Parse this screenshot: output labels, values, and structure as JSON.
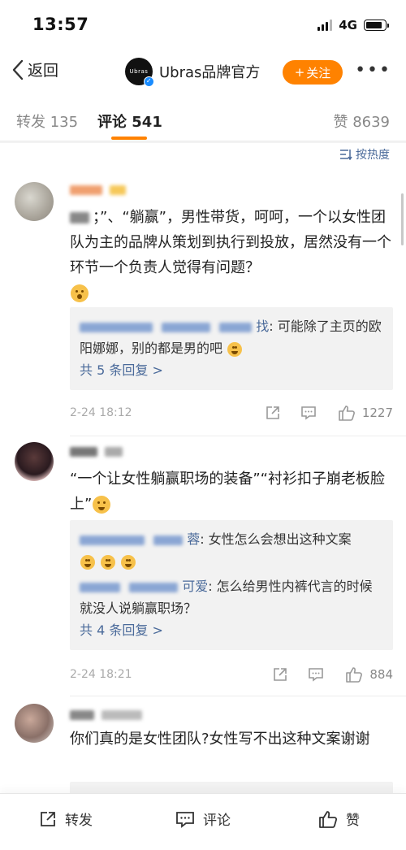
{
  "status_bar": {
    "time": "13:57",
    "network": "4G",
    "battery_level": 0.85,
    "signal_bars": 3
  },
  "nav": {
    "back_label": "返回",
    "brand_avatar_text": "Ubras",
    "brand_name": "Ubras品牌官方",
    "follow_label": "关注",
    "follow_prefix": "+"
  },
  "tabs": {
    "repost": "转发 135",
    "comment": "评论 541",
    "like": "赞 8639"
  },
  "sort_label": "按热度",
  "comments": [
    {
      "text": "\"躺赢\"、\"躺赢\"，男性带货，呵呵，一个以女性团队为主的品牌从策划到执行到投放，居然没有一个环节一个负责人觉得有问题？",
      "text_display": "；”、“躺赢”，男性带货，呵呵，一个以女性团队为主的品牌从策划到执行到投放，居然没有一个环节一个负责人觉得有问题？",
      "replies": [
        {
          "user_suffix": "找",
          "text": ": 可能除了主页的欧阳娜娜，别的都是男的吧"
        }
      ],
      "more_replies": "共 5 条回复 >",
      "time": "2-24 18:12",
      "likes": "1227"
    },
    {
      "text_display": "“一个让女性躺赢职场的装备”“衬衫扣子崩老板脸上”",
      "replies": [
        {
          "user_suffix": "蓉",
          "text": ": 女性怎么会想出这种文案"
        },
        {
          "user_suffix": "可爱",
          "text": ": 怎么给男性内裤代言的时候就没人说躺赢职场？"
        }
      ],
      "more_replies": "共 4 条回复 >",
      "time": "2-24 18:21",
      "likes": "884"
    },
    {
      "text_display": "你们真的是女性团队?女性写不出这种文案谢谢"
    }
  ],
  "bottom_bar": {
    "repost": "转发",
    "comment": "评论",
    "like": "赞"
  },
  "colors": {
    "accent": "#ff8200",
    "link": "#4a6a9a"
  }
}
